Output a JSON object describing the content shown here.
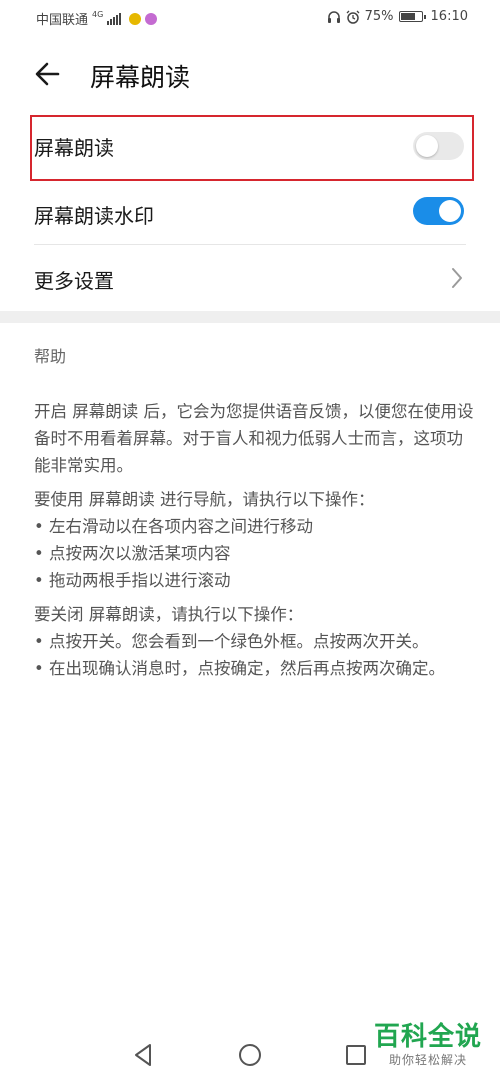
{
  "status_bar": {
    "carrier": "中国联通",
    "network": "4G",
    "battery": "75%",
    "battery_level": 0.75,
    "time": "16:10",
    "icons": [
      "signal-icon",
      "app-notification-icon",
      "app-notification-icon",
      "headset-icon",
      "alarm-icon",
      "battery-icon"
    ]
  },
  "header": {
    "title": "屏幕朗读"
  },
  "settings": {
    "screen_reader": {
      "label": "屏幕朗读",
      "enabled": false
    },
    "watermark": {
      "label": "屏幕朗读水印",
      "enabled": true
    },
    "more": {
      "label": "更多设置"
    }
  },
  "help": {
    "title": "帮助",
    "paragraphs": [
      "开启 屏幕朗读 后，它会为您提供语音反馈，以便您在使用设备时不用看着屏幕。对于盲人和视力低弱人士而言，这项功能非常实用。",
      "要使用 屏幕朗读 进行导航，请执行以下操作：\n• 左右滑动以在各项内容之间进行移动\n• 点按两次以激活某项内容\n• 拖动两根手指以进行滚动",
      "要关闭 屏幕朗读，请执行以下操作：\n• 点按开关。您会看到一个绿色外框。点按两次开关。\n• 在出现确认消息时，点按确定，然后再点按两次确定。"
    ]
  },
  "nav_bar": {
    "buttons": [
      "back-icon",
      "home-icon",
      "recents-icon"
    ]
  },
  "watermark": {
    "main": "百科全说",
    "sub": "助你轻松解决"
  },
  "colors": {
    "toggle_on": "#1a8de8",
    "toggle_off": "#e9e9e9",
    "highlight": "#d6262e",
    "watermark_green": "#21a650"
  }
}
